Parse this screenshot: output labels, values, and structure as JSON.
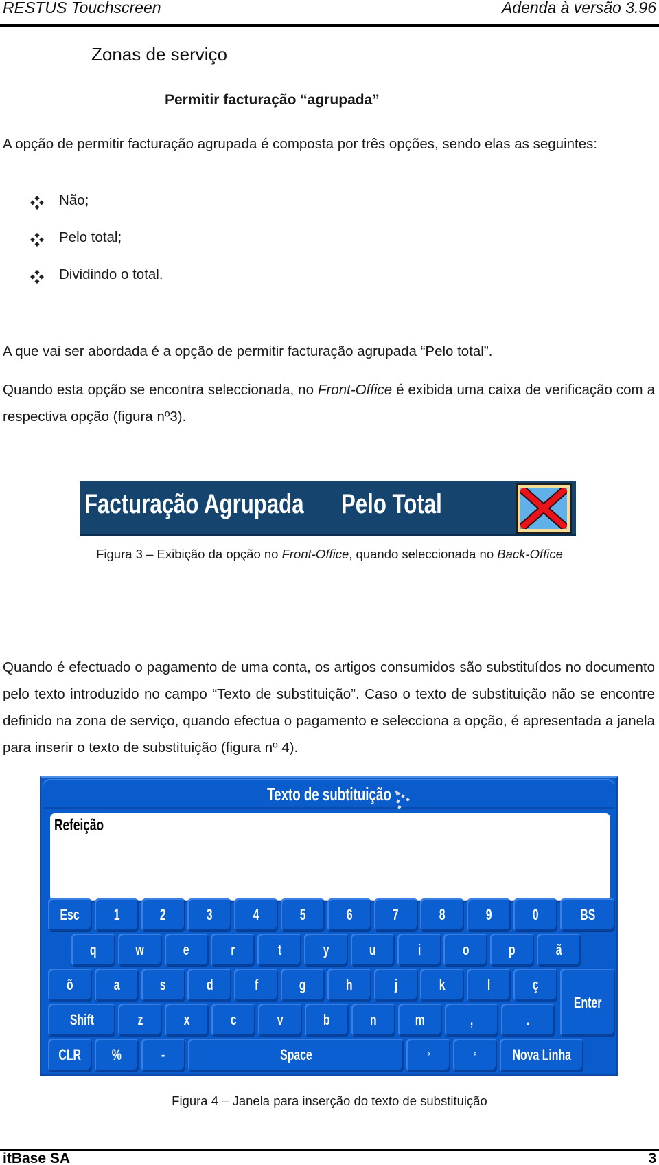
{
  "header": {
    "left": "RESTUS Touchscreen",
    "right": "Adenda à versão 3.96"
  },
  "section_title": "Zonas de serviço",
  "subsection_title": "Permitir facturação “agrupada”",
  "paragraphs": {
    "intro": "A opção de permitir facturação agrupada é composta por três opções, sendo elas as seguintes:",
    "focus": "A que vai ser abordada é a opção de permitir facturação agrupada “Pelo total”.",
    "when_selected_a": "Quando esta opção se encontra seleccionada, no ",
    "when_selected_it": "Front-Office",
    "when_selected_b": " é exibida uma caixa de verificação com a respectiva opção (figura nº3).",
    "payment": "Quando é efectuado o pagamento de uma conta, os artigos consumidos são substituídos no documento pelo texto introduzido no campo “Texto de substituição”. Caso o texto de substituição não se encontre definido na zona de serviço, quando efectua o pagamento e selecciona a opção, é apresentada a janela para inserir o texto de substituição (figura nº 4)."
  },
  "options": [
    {
      "label": "Não;",
      "icon": "diamond-bullet-icon"
    },
    {
      "label": "Pelo total;",
      "icon": "diamond-bullet-icon"
    },
    {
      "label": "Dividindo o total.",
      "icon": "diamond-bullet-icon"
    }
  ],
  "figure3": {
    "label": "Facturação Agrupada",
    "value": "Pelo Total",
    "checkbox_icon": "x-mark-icon",
    "checkbox_state": "checked",
    "colors": {
      "banner": "#15446e",
      "check_bg": "#62b0ea",
      "check_mark": "#e8141c",
      "check_border": "#f5dd98"
    },
    "caption_a": "Figura 3 – Exibição da opção no ",
    "caption_it1": "Front-Office",
    "caption_b": ", quando seleccionada no ",
    "caption_it2": "Back-Office"
  },
  "figure4": {
    "window_title": "Texto de subtituição",
    "text_value": "Refeição",
    "colors": {
      "window": "#0a5ccc",
      "key": "#0c5fd0",
      "text": "#ffffff"
    },
    "keyboard": {
      "row1": [
        "Esc",
        "1",
        "2",
        "3",
        "4",
        "5",
        "6",
        "7",
        "8",
        "9",
        "0",
        "BS"
      ],
      "row2": [
        "q",
        "w",
        "e",
        "r",
        "t",
        "y",
        "u",
        "i",
        "o",
        "p",
        "ã"
      ],
      "row3": [
        "õ",
        "a",
        "s",
        "d",
        "f",
        "g",
        "h",
        "j",
        "k",
        "l",
        "ç"
      ],
      "row4": [
        "Shift",
        "z",
        "x",
        "c",
        "v",
        "b",
        "n",
        "m",
        ",",
        "."
      ],
      "row5": [
        "CLR",
        "%",
        "-",
        "Space",
        "º",
        "ª",
        "Nova Linha"
      ],
      "enter": "Enter"
    },
    "caption": "Figura 4 – Janela para inserção do texto de substituição"
  },
  "footer": {
    "left": "itBase SA",
    "page_number": "3"
  }
}
